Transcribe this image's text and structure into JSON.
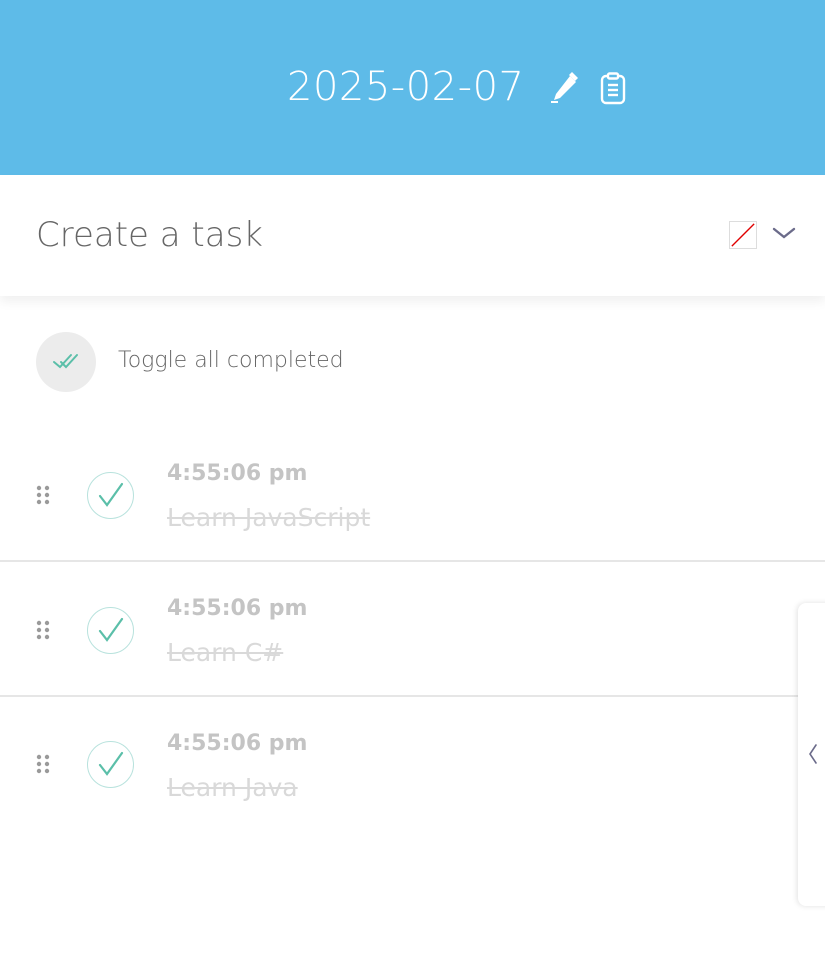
{
  "header": {
    "date": "2025-02-07",
    "background": "#5ebbe8",
    "edit_icon": "pencil-icon",
    "clipboard_icon": "clipboard-icon"
  },
  "create": {
    "placeholder": "Create a task",
    "color_swatch": "no-color",
    "chevron_icon": "chevron-down-icon"
  },
  "toggle_all": {
    "label": "Toggle all completed",
    "icon": "double-check-icon"
  },
  "tasks": [
    {
      "time": "4:55:06 pm",
      "text": "Learn JavaScript",
      "completed": true
    },
    {
      "time": "4:55:06 pm",
      "text": "Learn C#",
      "completed": true
    },
    {
      "time": "4:55:06 pm",
      "text": "Learn Java",
      "completed": true
    }
  ],
  "side_panel": {
    "icon": "chevron-left-icon"
  },
  "colors": {
    "accent": "#5ebbe8",
    "check": "#5bbfa9",
    "completed_text": "#d9d9d9"
  }
}
